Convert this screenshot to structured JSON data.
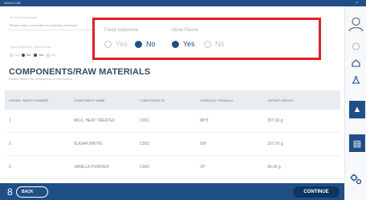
{
  "window": {
    "title": "MANU-FAB",
    "close_glyph": "×"
  },
  "message": {
    "label": "On-board message",
    "value": "Please enter a comment or a warning message"
  },
  "bg_options": {
    "fixed_label": "Fixed sequence",
    "pause_label": "Allow Pause",
    "yes": "Yes",
    "no": "No",
    "fixed_selected": "No",
    "pause_selected": "Yes"
  },
  "popup": {
    "fixed_sequence": {
      "label": "Fixed sequence",
      "yes": "Yes",
      "no": "No",
      "selected": "No"
    },
    "allow_pause": {
      "label": "Allow Pause",
      "yes": "Yes",
      "no": "No",
      "selected": "Yes"
    },
    "border_color": "#e0202a"
  },
  "section": {
    "title": "COMPONENTS/RAW MATERIALS",
    "subtitle": "Please define the components in this section"
  },
  "table": {
    "headers": [
      "ORDER / BATCH NUMBER",
      "COMPONENT NAME",
      "COMPONENT ID",
      "CHEMICAL FORMULA",
      "TARGET WEIGHT"
    ],
    "rows": [
      [
        "1",
        "MILK, HEAT TREATED",
        "C001",
        "MHT",
        "357.00 g"
      ],
      [
        "2",
        "SUGAR,WHITE",
        "C002",
        "SW",
        "107.00 g"
      ],
      [
        "3",
        "VANILLA POWDER",
        "C003",
        "VP",
        "36.00 g"
      ]
    ]
  },
  "footer": {
    "step": "8",
    "back_label": "BACK",
    "continue_label": "CONTINUE"
  },
  "rail_icons": [
    "user-icon",
    "badge-icon",
    "home-icon",
    "flask-icon",
    "scale-icon",
    "document-icon",
    "settings-icon"
  ],
  "colors": {
    "primary": "#1f4f86",
    "highlight": "#e0202a"
  }
}
